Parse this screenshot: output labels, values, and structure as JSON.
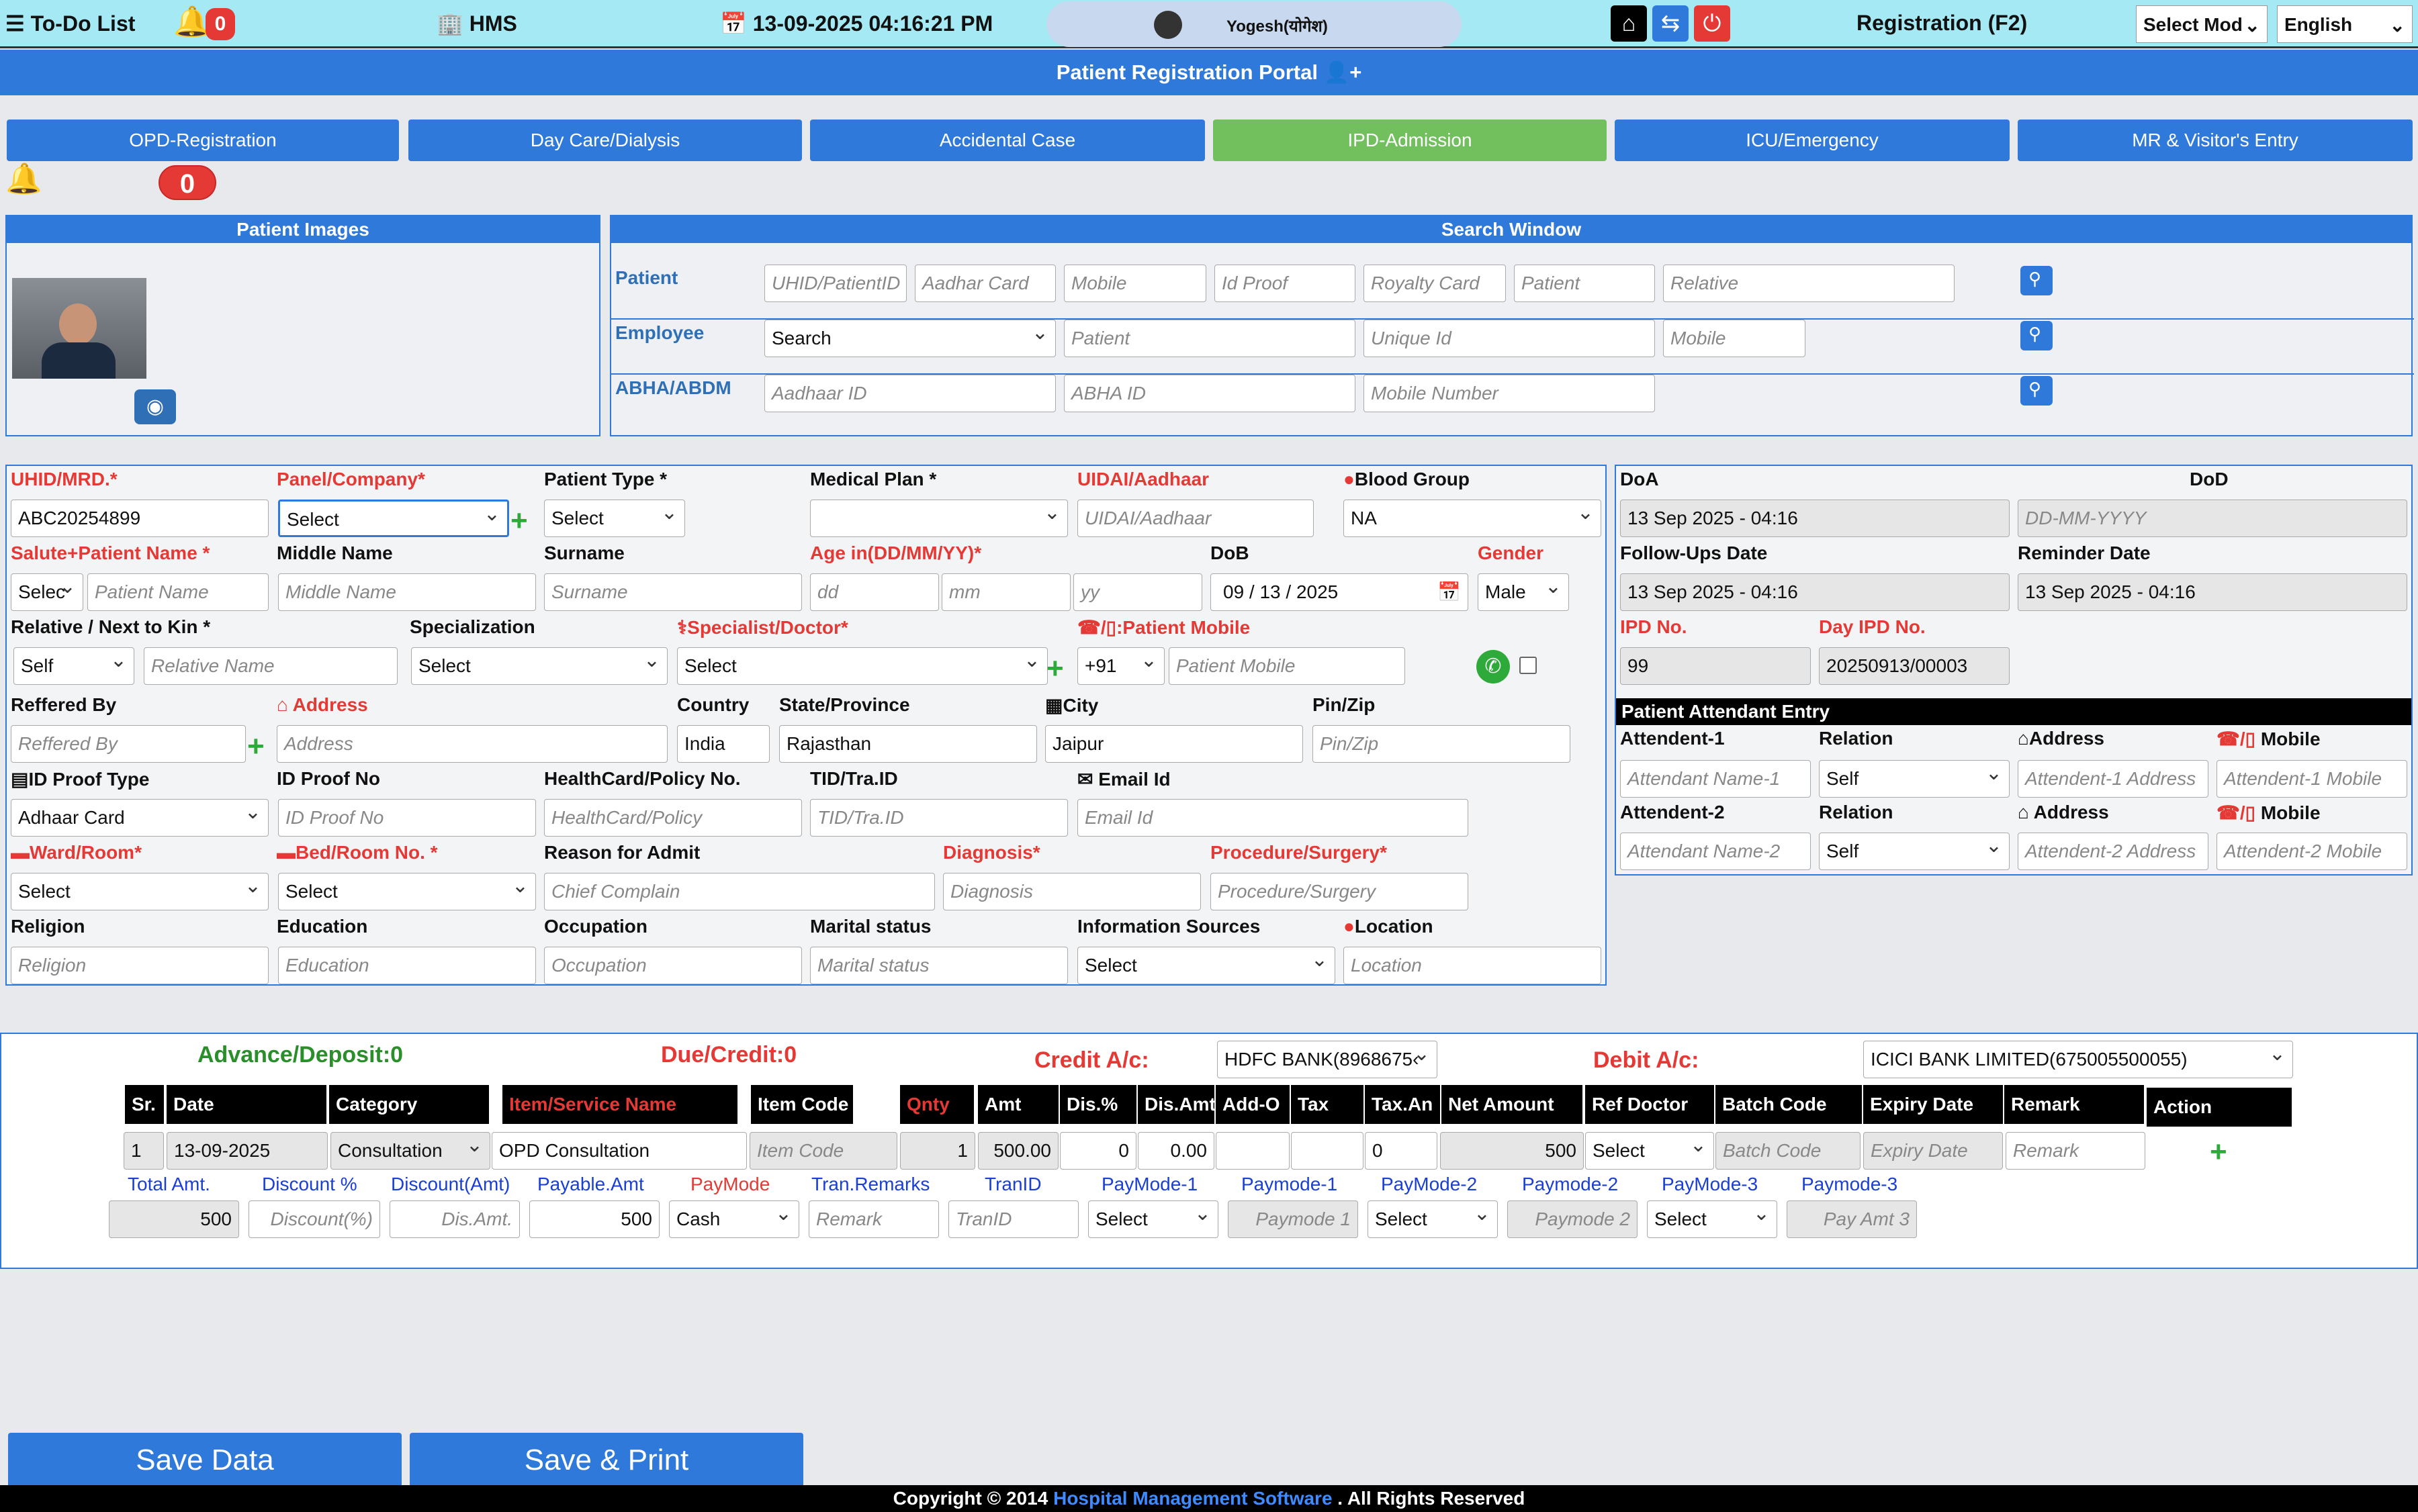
{
  "topbar": {
    "todo": "To-Do List",
    "todo_badge": "0",
    "app": "HMS",
    "datetime": "13-09-2025 04:16:21 PM",
    "user": "Yogesh(योगेश)",
    "registration": "Registration (F2)",
    "select_mode": "Select Mod",
    "language": "English"
  },
  "portal_title": "Patient Registration Portal",
  "tabs": [
    "OPD-Registration",
    "Day Care/Dialysis",
    "Accidental Case",
    "IPD-Admission",
    "ICU/Emergency",
    "MR & Visitor's Entry"
  ],
  "alert_count": "0",
  "images_panel": {
    "title": "Patient Images"
  },
  "search": {
    "title": "Search Window",
    "patient_label": "Patient",
    "employee_label": "Employee",
    "abha_label": "ABHA/ABDM",
    "patient_fields": [
      "UHID/PatientID",
      "Aadhar Card",
      "Mobile",
      "Id Proof",
      "Royalty Card",
      "Patient",
      "Relative"
    ],
    "employee_select": "Search",
    "employee_fields": [
      "Patient",
      "Unique Id",
      "Mobile"
    ],
    "abha_fields": [
      "Aadhaar ID",
      "ABHA ID",
      "Mobile Number"
    ]
  },
  "form": {
    "uhid_label": "UHID/MRD.*",
    "uhid_value": "ABC20254899",
    "panel_label": "Panel/Company*",
    "panel_value": "Select",
    "ptype_label": "Patient Type *",
    "ptype_value": "Select",
    "plan_label": "Medical Plan *",
    "uidai_label": "UIDAI/Aadhaar",
    "uidai_ph": "UIDAI/Aadhaar",
    "blood_label": "Blood Group",
    "blood_value": "NA",
    "salute_label": "Salute+Patient Name *",
    "salute_value": "Selec",
    "pname_ph": "Patient Name",
    "middle_label": "Middle Name",
    "middle_ph": "Middle Name",
    "surname_label": "Surname",
    "surname_ph": "Surname",
    "age_label": "Age in(DD/MM/YY)*",
    "dd": "dd",
    "mm": "mm",
    "yy": "yy",
    "dob_label": "DoB",
    "dob_value": "09 / 13 / 2025",
    "gender_label": "Gender",
    "gender_value": "Male",
    "relative_label": "Relative / Next to Kin *",
    "relative_value": "Self",
    "relname_ph": "Relative Name",
    "spec_label": "Specialization",
    "spec_value": "Select",
    "doctor_label": "Specialist/Doctor*",
    "doctor_value": "Select",
    "mobile_label": ":Patient Mobile",
    "code_value": "+91",
    "mobile_ph": "Patient Mobile",
    "ref_label": "Reffered By",
    "ref_ph": "Reffered By",
    "addr_label": "Address",
    "addr_ph": "Address",
    "country_label": "Country",
    "country_value": "India",
    "state_label": "State/Province",
    "state_value": "Rajasthan",
    "city_label": "City",
    "city_value": "Jaipur",
    "pin_label": "Pin/Zip",
    "pin_ph": "Pin/Zip",
    "idtype_label": "ID Proof Type",
    "idtype_value": "Adhaar Card",
    "idno_label": "ID Proof No",
    "idno_ph": "ID Proof No",
    "health_label": "HealthCard/Policy No.",
    "health_ph": "HealthCard/Policy",
    "tid_label": "TID/Tra.ID",
    "tid_ph": "TID/Tra.ID",
    "email_label": "Email Id",
    "email_ph": "Email Id",
    "ward_label": "Ward/Room*",
    "ward_value": "Select",
    "bed_label": "Bed/Room No. *",
    "bed_value": "Select",
    "reason_label": "Reason for Admit",
    "reason_ph": "Chief Complain",
    "diag_label": "Diagnosis*",
    "diag_ph": "Diagnosis",
    "proc_label": "Procedure/Surgery*",
    "proc_ph": "Procedure/Surgery",
    "religion_label": "Religion",
    "religion_ph": "Religion",
    "edu_label": "Education",
    "edu_ph": "Education",
    "occ_label": "Occupation",
    "occ_ph": "Occupation",
    "marital_label": "Marital status",
    "marital_ph": "Marital status",
    "info_label": "Information Sources",
    "info_value": "Select",
    "loc_label": "Location",
    "loc_ph": "Location"
  },
  "right": {
    "doa_label": "DoA",
    "doa_value": "13 Sep 2025 - 04:16",
    "dod_label": "DoD",
    "dod_ph": "DD-MM-YYYY",
    "follow_label": "Follow-Ups Date",
    "follow_value": "13 Sep 2025 - 04:16",
    "reminder_label": "Reminder Date",
    "reminder_value": "13 Sep 2025 - 04:16",
    "ipd_label": "IPD No.",
    "ipd_value": "99",
    "dayipd_label": "Day IPD No.",
    "dayipd_value": "20250913/00003",
    "attendant_title": "Patient Attendant Entry",
    "att1_label": "Attendent-1",
    "att2_label": "Attendent-2",
    "relation_label": "Relation",
    "address_label": "Address",
    "address2_label": " Address",
    "mobile_label": "Mobile",
    "att1_name_ph": "Attendant Name-1",
    "att1_rel": "Self",
    "att1_addr_ph": "Attendent-1 Address",
    "att1_mob_ph": "Attendent-1 Mobile",
    "att2_name_ph": "Attendant Name-2",
    "att2_rel": "Self",
    "att2_addr_ph": "Attendent-2 Address",
    "att2_mob_ph": "Attendent-2 Mobile"
  },
  "billing": {
    "advance": "Advance/Deposit:0",
    "due": "Due/Credit:0",
    "credit_label": "Credit A/c:",
    "credit_value": "HDFC BANK(8968675‹",
    "debit_label": "Debit A/c:",
    "debit_value": "ICICI BANK LIMITED(675005500055)",
    "headers": [
      "Sr.",
      "Date",
      "Category",
      "Item/Service Name",
      "Item Code",
      "Qnty",
      "Amt",
      "Dis.%",
      "Dis.Amt",
      "Add-O",
      "Tax",
      "Tax.An",
      "Net Amount",
      "Ref Doctor",
      "Batch Code",
      "Expiry Date",
      "Remark",
      "Action"
    ],
    "row": {
      "sr": "1",
      "date": "13-09-2025",
      "category": "Consultation",
      "item": "OPD Consultation",
      "code_ph": "Item Code",
      "qty": "1",
      "amt": "500.00",
      "dis_pct": "0",
      "dis_amt": "0.00",
      "taxam": "0",
      "net": "500",
      "ref": "Select",
      "batch_ph": "Batch Code",
      "expiry_ph": "Expiry Date",
      "remark_ph": "Remark"
    },
    "pay_labels": [
      "Total Amt.",
      "Discount %",
      "Discount(Amt)",
      "Payable.Amt",
      "PayMode",
      "Tran.Remarks",
      "TranID",
      "PayMode-1",
      "Paymode-1",
      "PayMode-2",
      "Paymode-2",
      "PayMode-3",
      "Paymode-3"
    ],
    "pay": {
      "total": "500",
      "disc_pct_ph": "Discount(%)",
      "disc_amt_ph": "Dis.Amt.",
      "payable": "500",
      "mode": "Cash",
      "remark_ph": "Remark",
      "tran_ph": "TranID",
      "pm1": "Select",
      "pm1_ph": "Paymode 1",
      "pm2": "Select",
      "pm2_ph": "Paymode 2",
      "pm3": "Select",
      "pm3_ph": "Pay Amt 3"
    }
  },
  "actions": {
    "save": "Save Data",
    "save_print": "Save & Print"
  },
  "footer": {
    "pre": "Copyright © 2014 ",
    "link": "Hospital Management Software",
    "post": " . All Rights Reserved"
  }
}
